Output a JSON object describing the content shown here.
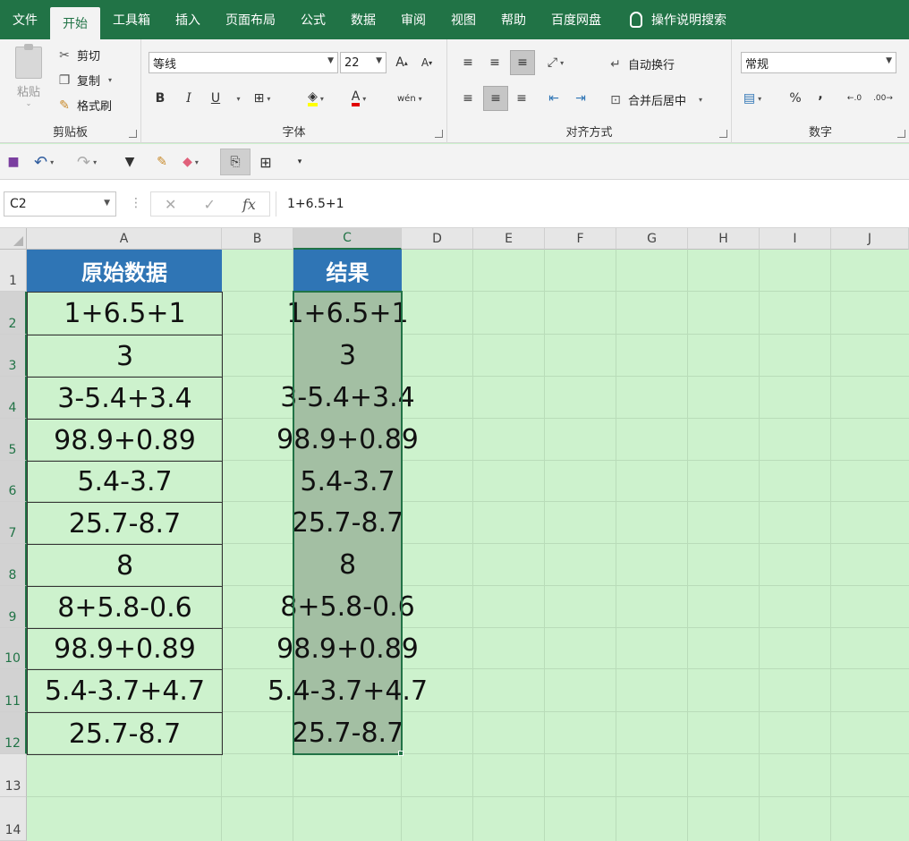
{
  "menu": {
    "tabs": [
      "文件",
      "开始",
      "工具箱",
      "插入",
      "页面布局",
      "公式",
      "数据",
      "审阅",
      "视图",
      "帮助",
      "百度网盘"
    ],
    "active_tab": "开始",
    "search_label": "操作说明搜索"
  },
  "ribbon": {
    "clipboard": {
      "label": "剪贴板",
      "paste": "粘贴",
      "cut": "剪切",
      "copy": "复制",
      "format_painter": "格式刷"
    },
    "font": {
      "label": "字体",
      "font_name": "等线",
      "font_size": "22",
      "bold": "B",
      "italic": "I",
      "underline": "U",
      "grow": "A",
      "shrink": "A",
      "phonetic": "wén"
    },
    "alignment": {
      "label": "对齐方式",
      "wrap_text": "自动换行",
      "merge_center": "合并后居中"
    },
    "number": {
      "label": "数字",
      "format": "常规",
      "percent": "%",
      "comma": ","
    }
  },
  "formula_bar": {
    "name_box": "C2",
    "fx": "fx",
    "formula": "1+6.5+1"
  },
  "columns": [
    "A",
    "B",
    "C",
    "D",
    "E",
    "F",
    "G",
    "H",
    "I",
    "J"
  ],
  "rows": [
    "1",
    "2",
    "3",
    "4",
    "5",
    "6",
    "7",
    "8",
    "9",
    "10",
    "11",
    "12",
    "13",
    "14"
  ],
  "selected_column": "C",
  "selected_range": "C2:C12",
  "sheet": {
    "header_a": "原始数据",
    "header_c": "结果",
    "col_a": [
      "1+6.5+1",
      "3",
      "3-5.4+3.4",
      "98.9+0.89",
      "5.4-3.7",
      "25.7-8.7",
      "8",
      "8+5.8-0.6",
      "98.9+0.89",
      "5.4-3.7+4.7",
      "25.7-8.7"
    ],
    "col_c": [
      "1+6.5+1",
      "3",
      "3-5.4+3.4",
      "98.9+0.89",
      "5.4-3.7",
      "25.7-8.7",
      "8",
      "8+5.8-0.6",
      "98.9+0.89",
      "5.4-3.7+4.7",
      "25.7-8.7"
    ]
  },
  "colors": {
    "accent": "#217346",
    "header_fill": "#2f75b5",
    "sheet_bg": "#cdf2cd",
    "selection": "#a3bfa3"
  }
}
